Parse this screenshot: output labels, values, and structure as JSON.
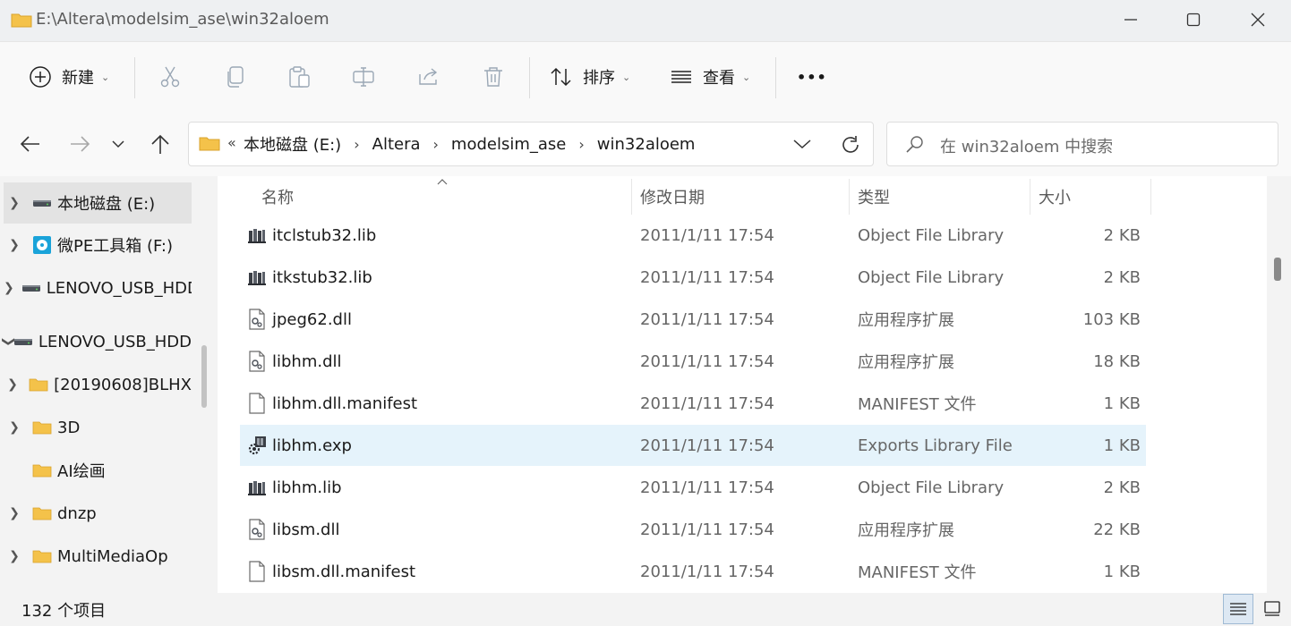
{
  "window": {
    "title": "E:\\Altera\\modelsim_ase\\win32aloem"
  },
  "toolbar": {
    "new_label": "新建",
    "sort_label": "排序",
    "view_label": "查看",
    "more_label": "•••"
  },
  "address": {
    "prefix": "«",
    "crumbs": [
      "本地磁盘 (E:)",
      "Altera",
      "modelsim_ase",
      "win32aloem"
    ]
  },
  "search": {
    "placeholder": "在 win32aloem 中搜索"
  },
  "sidebar": {
    "items": [
      {
        "label": "本地磁盘 (E:)",
        "icon": "drive-icon"
      },
      {
        "label": "微PE工具箱 (F:)",
        "icon": "pe-drive-icon"
      },
      {
        "label": "LENOVO_USB_HDD",
        "icon": "drive-icon"
      },
      {
        "label": "LENOVO_USB_HDD",
        "icon": "drive-icon"
      },
      {
        "label": "[20190608]BLHX",
        "icon": "folder-icon"
      },
      {
        "label": "3D",
        "icon": "folder-icon"
      },
      {
        "label": "AI绘画",
        "icon": "folder-icon"
      },
      {
        "label": "dnzp",
        "icon": "folder-icon"
      },
      {
        "label": "MultiMediaOp",
        "icon": "folder-icon"
      }
    ]
  },
  "columns": {
    "name": "名称",
    "date": "修改日期",
    "type": "类型",
    "size": "大小"
  },
  "files": [
    {
      "name": "itclstub32.lib",
      "date": "2011/1/11 17:54",
      "type": "Object File Library",
      "size": "2 KB",
      "icon": "lib-icon"
    },
    {
      "name": "itkstub32.lib",
      "date": "2011/1/11 17:54",
      "type": "Object File Library",
      "size": "2 KB",
      "icon": "lib-icon"
    },
    {
      "name": "jpeg62.dll",
      "date": "2011/1/11 17:54",
      "type": "应用程序扩展",
      "size": "103 KB",
      "icon": "dll-icon"
    },
    {
      "name": "libhm.dll",
      "date": "2011/1/11 17:54",
      "type": "应用程序扩展",
      "size": "18 KB",
      "icon": "dll-icon"
    },
    {
      "name": "libhm.dll.manifest",
      "date": "2011/1/11 17:54",
      "type": "MANIFEST 文件",
      "size": "1 KB",
      "icon": "file-icon"
    },
    {
      "name": "libhm.exp",
      "date": "2011/1/11 17:54",
      "type": "Exports Library File",
      "size": "1 KB",
      "icon": "exp-icon"
    },
    {
      "name": "libhm.lib",
      "date": "2011/1/11 17:54",
      "type": "Object File Library",
      "size": "2 KB",
      "icon": "lib-icon"
    },
    {
      "name": "libsm.dll",
      "date": "2011/1/11 17:54",
      "type": "应用程序扩展",
      "size": "22 KB",
      "icon": "dll-icon"
    },
    {
      "name": "libsm.dll.manifest",
      "date": "2011/1/11 17:54",
      "type": "MANIFEST 文件",
      "size": "1 KB",
      "icon": "file-icon"
    }
  ],
  "status": {
    "item_count": "132 个项目"
  },
  "colors": {
    "folder": "#f4c24a",
    "highlight_row": "#e5f3fb",
    "selected_nav": "#e3e3e3"
  }
}
